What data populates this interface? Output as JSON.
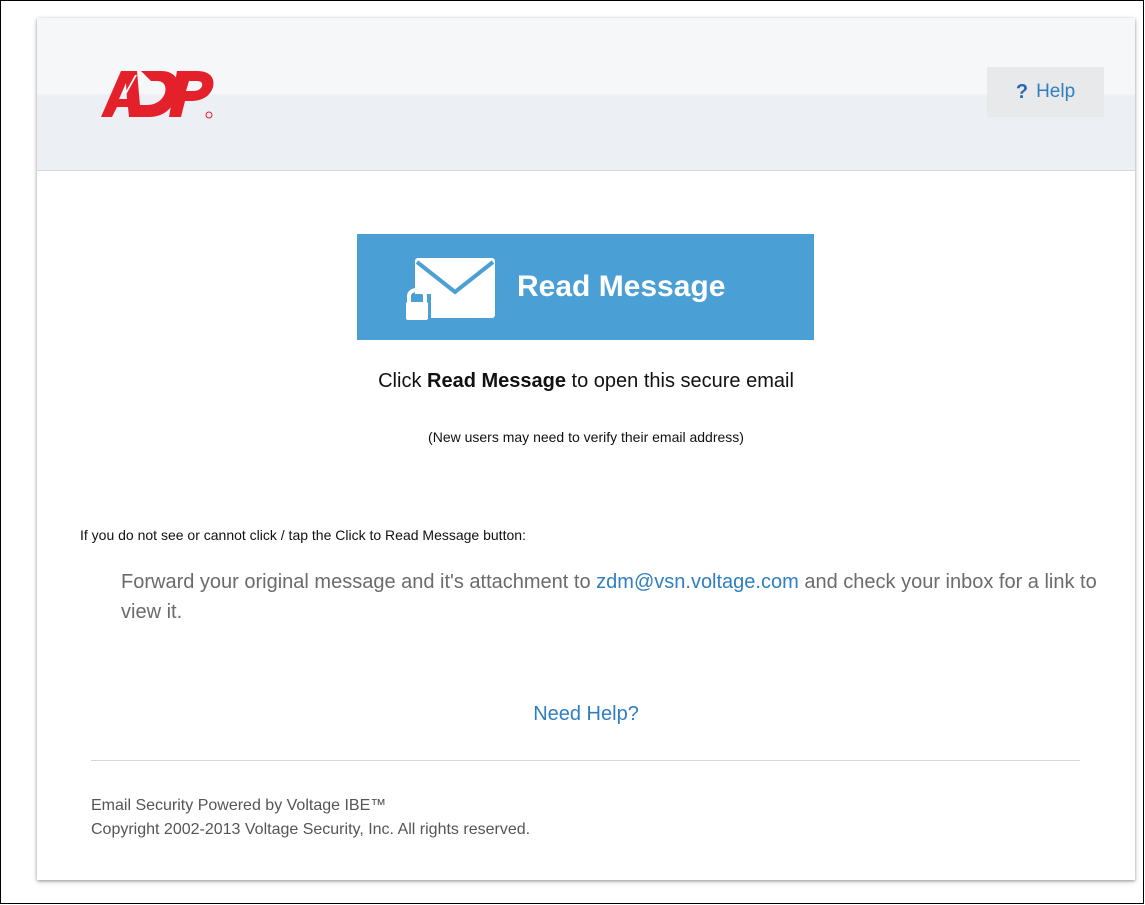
{
  "header": {
    "logo_alt": "ADP",
    "help_label": "Help",
    "help_icon": "question-mark-icon"
  },
  "main": {
    "read_button_label": "Read Message",
    "read_button_icon": "envelope-lock-icon",
    "instruction_prefix": "Click",
    "instruction_bold": "Read Message",
    "instruction_suffix": "to open this secure email",
    "subnote": "(New users may need to verify their email address)",
    "fallback_heading": "If you do not see or cannot click / tap the Click to Read Message button:",
    "forward_prefix": "Forward your original message and it's attachment to",
    "forward_email": "zdm@vsn.voltage.com",
    "forward_suffix": "and check your inbox for a link to view it.",
    "need_help": "Need Help?"
  },
  "footer": {
    "line1": "Email Security Powered by Voltage IBE™",
    "line2": "Copyright 2002-2013 Voltage Security, Inc. All rights reserved."
  },
  "colors": {
    "brand_red": "#e4202a",
    "button_blue": "#4a9fd4",
    "link_blue": "#2f7fc0"
  }
}
